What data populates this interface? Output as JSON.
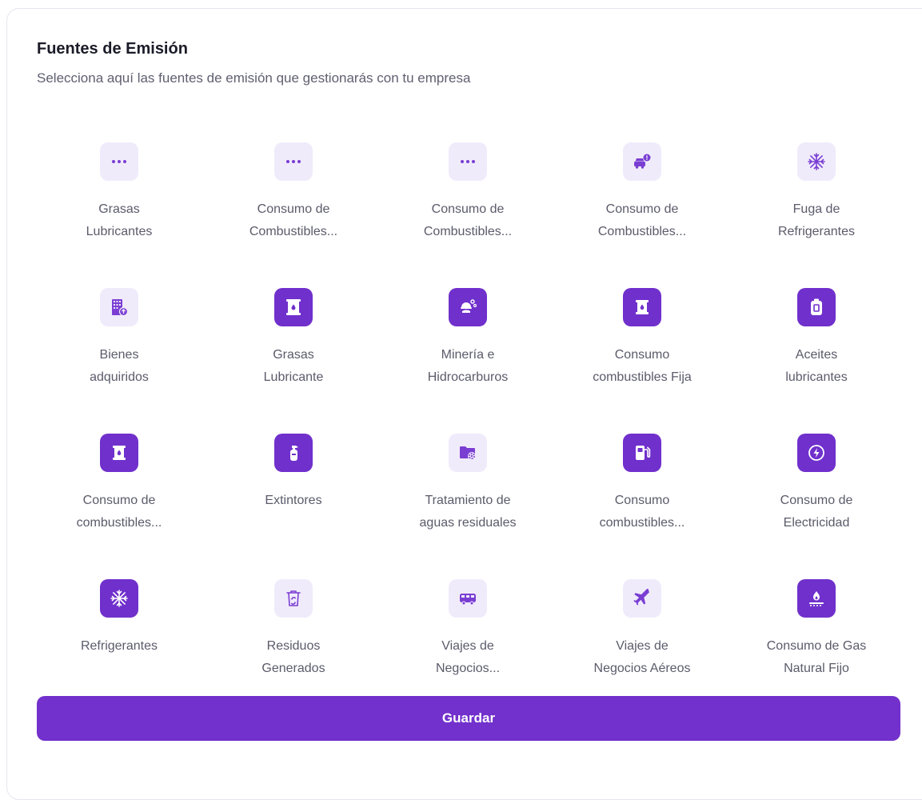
{
  "header": {
    "title": "Fuentes de Emisión",
    "subtitle": "Selecciona aquí las fuentes de emisión que gestionarás con tu empresa"
  },
  "sources": [
    {
      "label": "Grasas\nLubricantes",
      "icon": "more-dots-icon",
      "selected": false
    },
    {
      "label": "Consumo de\nCombustibles...",
      "icon": "more-dots-icon",
      "selected": false
    },
    {
      "label": "Consumo de\nCombustibles...",
      "icon": "more-dots-icon",
      "selected": false
    },
    {
      "label": "Consumo de\nCombustibles...",
      "icon": "car-alert-icon",
      "selected": false
    },
    {
      "label": "Fuga de\nRefrigerantes",
      "icon": "snowflake-icon",
      "selected": false
    },
    {
      "label": "Bienes\nadquiridos",
      "icon": "building-upload-icon",
      "selected": false
    },
    {
      "label": "Grasas\nLubricante",
      "icon": "oil-barrel-icon",
      "selected": true
    },
    {
      "label": "Minería e\nHidrocarburos",
      "icon": "mining-worker-icon",
      "selected": true
    },
    {
      "label": "Consumo\ncombustibles Fija",
      "icon": "fuel-barrel-icon",
      "selected": true
    },
    {
      "label": "Aceites\nlubricantes",
      "icon": "oil-canister-icon",
      "selected": true
    },
    {
      "label": "Consumo de\ncombustibles...",
      "icon": "fuel-barrel-icon",
      "selected": true
    },
    {
      "label": "Extintores",
      "icon": "fire-extinguisher-icon",
      "selected": true
    },
    {
      "label": "Tratamiento de\naguas residuales",
      "icon": "folder-gear-icon",
      "selected": false
    },
    {
      "label": "Consumo\ncombustibles...",
      "icon": "gas-pump-icon",
      "selected": true
    },
    {
      "label": "Consumo de\nElectricidad",
      "icon": "electricity-bolt-icon",
      "selected": true
    },
    {
      "label": "Refrigerantes",
      "icon": "snowflake-icon",
      "selected": true
    },
    {
      "label": "Residuos\nGenerados",
      "icon": "recycle-bin-icon",
      "selected": false
    },
    {
      "label": "Viajes de\nNegocios...",
      "icon": "bus-icon",
      "selected": false
    },
    {
      "label": "Viajes de\nNegocios Aéreos",
      "icon": "airplane-icon",
      "selected": false
    },
    {
      "label": "Consumo de Gas\nNatural Fijo",
      "icon": "gas-flame-icon",
      "selected": true
    }
  ],
  "actions": {
    "save_label": "Guardar"
  },
  "colors": {
    "accent": "#7230cc",
    "tile_unselected_bg": "#f0ebfb",
    "tile_unselected_fg": "#7a3ed3",
    "text_primary": "#1b1b29",
    "text_secondary": "#5b5b6b"
  }
}
